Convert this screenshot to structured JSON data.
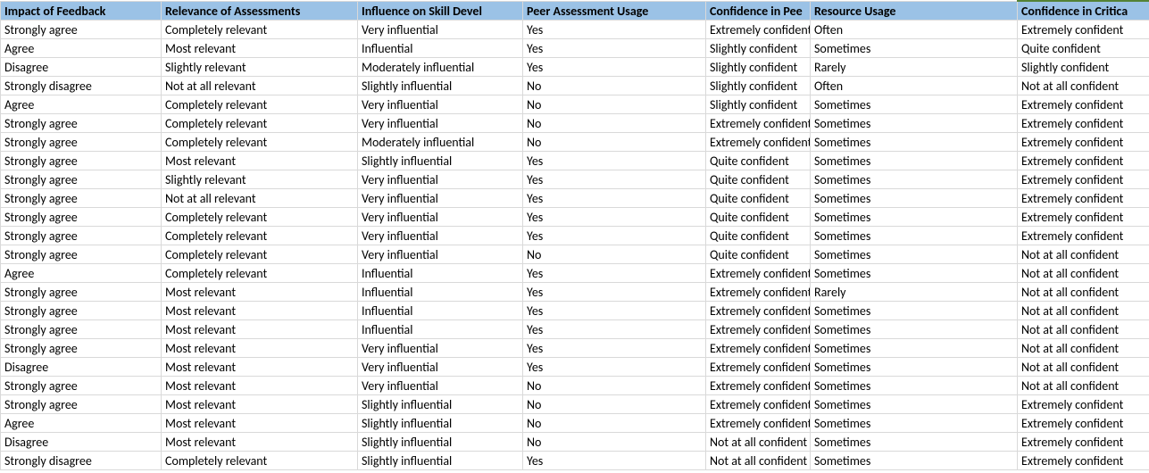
{
  "table": {
    "headers": [
      "Impact of Feedback",
      "Relevance of Assessments",
      "Influence on Skill Devel",
      "Peer Assessment Usage",
      "Confidence in Pee",
      "Resource Usage",
      "Confidence in Critica"
    ],
    "rows": [
      [
        "Strongly agree",
        "Completely relevant",
        "Very influential",
        "Yes",
        "Extremely confident",
        "Often",
        "Extremely confident"
      ],
      [
        "Agree",
        "Most relevant",
        "Influential",
        "Yes",
        "Slightly confident",
        "Sometimes",
        "Quite confident"
      ],
      [
        "Disagree",
        "Slightly relevant",
        "Moderately influential",
        "Yes",
        "Slightly confident",
        "Rarely",
        "Slightly confident"
      ],
      [
        "Strongly disagree",
        "Not at all relevant",
        "Slightly influential",
        "No",
        "Slightly confident",
        "Often",
        "Not at all confident"
      ],
      [
        "Agree",
        "Completely relevant",
        "Very influential",
        "No",
        "Slightly confident",
        "Sometimes",
        "Extremely confident"
      ],
      [
        "Strongly agree",
        "Completely relevant",
        "Very influential",
        "No",
        "Extremely confident",
        "Sometimes",
        "Extremely confident"
      ],
      [
        "Strongly agree",
        "Completely relevant",
        "Moderately influential",
        "No",
        "Extremely confident",
        "Sometimes",
        "Extremely confident"
      ],
      [
        "Strongly agree",
        "Most relevant",
        "Slightly influential",
        "Yes",
        "Quite confident",
        "Sometimes",
        "Extremely confident"
      ],
      [
        "Strongly agree",
        "Slightly relevant",
        "Very influential",
        "Yes",
        "Quite confident",
        "Sometimes",
        "Extremely confident"
      ],
      [
        "Strongly agree",
        "Not at all relevant",
        "Very influential",
        "Yes",
        "Quite confident",
        "Sometimes",
        "Extremely confident"
      ],
      [
        "Strongly agree",
        "Completely relevant",
        "Very influential",
        "Yes",
        "Quite confident",
        "Sometimes",
        "Extremely confident"
      ],
      [
        "Strongly agree",
        "Completely relevant",
        "Very influential",
        "Yes",
        "Quite confident",
        "Sometimes",
        "Extremely confident"
      ],
      [
        "Strongly agree",
        "Completely relevant",
        "Very influential",
        "No",
        "Quite confident",
        "Sometimes",
        "Not at all confident"
      ],
      [
        "Agree",
        "Completely relevant",
        "Influential",
        "Yes",
        "Extremely confident",
        "Sometimes",
        "Not at all confident"
      ],
      [
        "Strongly agree",
        "Most relevant",
        "Influential",
        "Yes",
        "Extremely confident",
        "Rarely",
        "Not at all confident"
      ],
      [
        "Strongly agree",
        "Most relevant",
        "Influential",
        "Yes",
        "Extremely confident",
        "Sometimes",
        "Not at all confident"
      ],
      [
        "Strongly agree",
        "Most relevant",
        "Influential",
        "Yes",
        "Extremely confident",
        "Sometimes",
        "Not at all confident"
      ],
      [
        "Strongly agree",
        "Most relevant",
        "Very influential",
        "Yes",
        "Extremely confident",
        "Sometimes",
        "Not at all confident"
      ],
      [
        "Disagree",
        "Most relevant",
        "Very influential",
        "Yes",
        "Extremely confident",
        "Sometimes",
        "Not at all confident"
      ],
      [
        "Strongly agree",
        "Most relevant",
        "Very influential",
        "No",
        "Extremely confident",
        "Sometimes",
        "Not at all confident"
      ],
      [
        "Strongly agree",
        "Most relevant",
        "Slightly influential",
        "No",
        "Extremely confident",
        "Sometimes",
        "Extremely confident"
      ],
      [
        "Agree",
        "Most relevant",
        "Slightly influential",
        "No",
        "Extremely confident",
        "Sometimes",
        "Extremely confident"
      ],
      [
        "Disagree",
        "Most relevant",
        "Slightly influential",
        "No",
        "Not at all confident",
        "Sometimes",
        "Extremely confident"
      ],
      [
        "Strongly disagree",
        "Completely relevant",
        "Slightly influential",
        "Yes",
        "Not at all confident",
        "Sometimes",
        "Extremely confident"
      ]
    ]
  }
}
